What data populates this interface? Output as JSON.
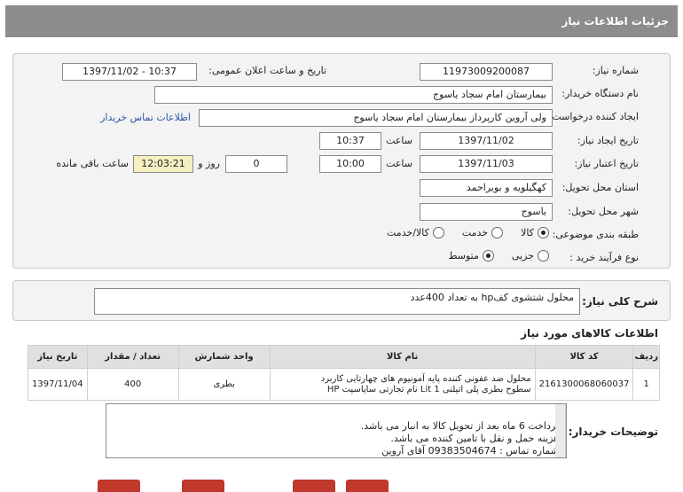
{
  "page": {
    "title": "جزئیات اطلاعات نیاز"
  },
  "fields": {
    "need_number_label": "شماره نیاز:",
    "need_number": "1197300920008‎7",
    "announce_label": "تاریخ و ساعت اعلان عمومی:",
    "announce_value": "1397/11/02 - 10:37",
    "buyer_label": "نام دستگاه خریدار:",
    "buyer": "بیمارستان امام سجاد یاسوج",
    "creator_label": "ایجاد کننده درخواست:",
    "creator": "ولی آروین کارپرداز بیمارستان امام سجاد یاسوج",
    "contact_link": "اطلاعات تماس خریدار",
    "created_date_label": "تاریخ ایجاد نیاز:",
    "created_date": "1397/11/02",
    "created_time_label": "ساعت",
    "created_time": "10:37",
    "validity_label": "تاریخ اعتبار نیاز:",
    "validity_date": "1397/11/03",
    "validity_time_label": "ساعت",
    "validity_time": "10:00",
    "days_value": "0",
    "days_label": "روز و",
    "remaining_time": "12:03:21",
    "remaining_label": "ساعت باقی مانده",
    "province_label": "استان محل تحویل:",
    "province": "کهگیلویه و بویراحمد",
    "city_label": "شهر محل تحویل:",
    "city": "یاسوج",
    "category_label": "طبقه بندی موضوعی:",
    "category_options": [
      "کالا",
      "خدمت",
      "کالا/خدمت"
    ],
    "category_selected": 0,
    "process_label": "نوع فرآیند خرید :",
    "process_options": [
      "جزیی",
      "متوسط"
    ],
    "process_selected": 1
  },
  "summary": {
    "label": "شرح کلی نیاز:",
    "value": "محلول شتشوی کفhp به تعداد 400عدد"
  },
  "items": {
    "title": "اطلاعات کالاهای مورد نیاز",
    "headers": [
      "ردیف",
      "کد کالا",
      "نام کالا",
      "واحد شمارش",
      "تعداد / مقدار",
      "تاریخ نیاز"
    ],
    "rows": [
      {
        "index": "1",
        "code": "2161300068060037",
        "name_line1": "محلول ضد عفونی کننده پایه آمونیوم های چهارتایی کاربرد",
        "name_line2": "سطوح بطری پلی اتیلنی 1 Lit نام تجارتی ساپاسپت HP",
        "unit": "بطری",
        "qty": "400",
        "date": "1397/11/04"
      }
    ]
  },
  "notes": {
    "label": "توضیحات خریدار:",
    "lines": [
      "پرداخت 6 ماه بعد از تحویل کالا به انبار می باشد.",
      "هزینه حمل و نقل با تامین کننده می باشد.",
      "شماره تماس : 09383504674 آقای آروین"
    ]
  },
  "colors": {
    "titlebar": "#8c8c8c",
    "link": "#2b55a6",
    "remaining_bg": "#f5efc2"
  }
}
